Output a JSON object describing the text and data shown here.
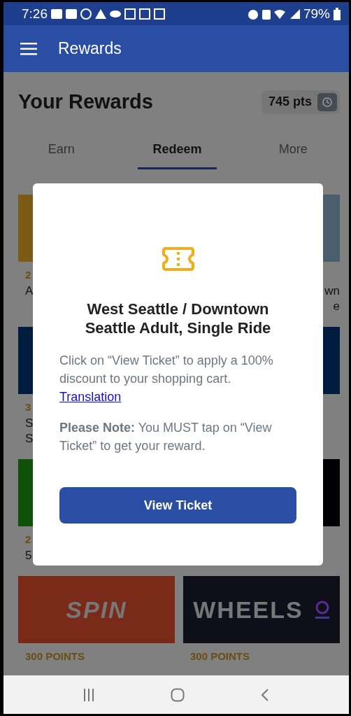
{
  "status_bar": {
    "time": "7:26",
    "battery": "79%"
  },
  "app_bar": {
    "title": "Rewards"
  },
  "header": {
    "title": "Your Rewards",
    "points": "745 pts"
  },
  "tabs": [
    {
      "label": "Earn",
      "selected": false
    },
    {
      "label": "Redeem",
      "selected": true
    },
    {
      "label": "More",
      "selected": false
    }
  ],
  "rewards": [
    {
      "kind": "partial",
      "color": "#7a5a14",
      "points": "2",
      "title_lines": [
        "A"
      ]
    },
    {
      "kind": "partial",
      "color": "#4a5e6c",
      "title_lines": [
        "wn",
        "e"
      ]
    },
    {
      "kind": "partial",
      "color": "#001c3e",
      "points": "3",
      "title_lines": [
        "S",
        "S"
      ]
    },
    {
      "kind": "partial",
      "color": "#001c3e"
    },
    {
      "kind": "partial",
      "color": "#0e520a",
      "points": "2",
      "title_lines": [
        "5"
      ]
    },
    {
      "kind": "partial",
      "color": "#020204"
    },
    {
      "kind": "full",
      "color": "#7a2a18",
      "logo": "SPIN",
      "points": "300 POINTS"
    },
    {
      "kind": "full",
      "color": "#0e0f18",
      "logo": "WHEELS",
      "points": "300 POINTS"
    }
  ],
  "dialog": {
    "title": "West Seattle / Downtown Seattle Adult, Single Ride",
    "body": "Click on “View Ticket” to apply a 100% discount to your shopping cart.",
    "link": "Translation",
    "note": "**Please Note:** You MUST tap on “View Ticket” to get your reward.",
    "button": "View Ticket"
  }
}
